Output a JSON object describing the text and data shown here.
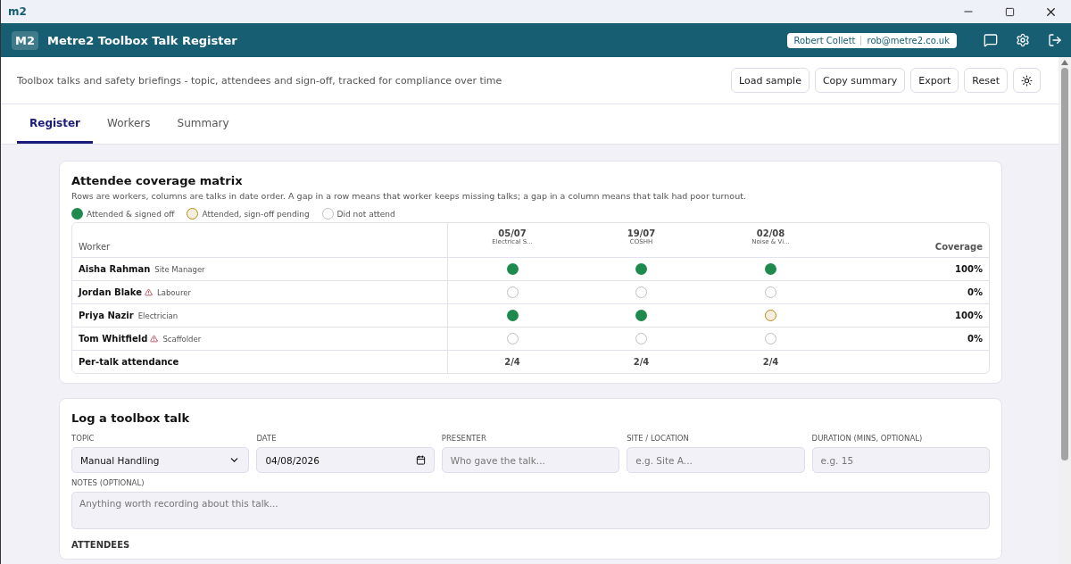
{
  "window": {
    "logo": "m2"
  },
  "app_bar": {
    "badge": "M2",
    "title": "Metre2 Toolbox Talk Register",
    "user_name": "Robert Collett",
    "user_email": "rob@metre2.co.uk"
  },
  "subtitle": "Toolbox talks and safety briefings - topic, attendees and sign-off, tracked for compliance over time",
  "actions": [
    "Load sample",
    "Copy summary",
    "Export",
    "Reset"
  ],
  "tabs": [
    {
      "label": "Register",
      "selected": true
    },
    {
      "label": "Workers",
      "selected": false
    },
    {
      "label": "Summary",
      "selected": false
    }
  ],
  "matrix": {
    "title": "Attendee coverage matrix",
    "description": "Rows are workers, columns are talks in date order. A gap in a row means that worker keeps missing talks; a gap in a column means that talk had poor turnout.",
    "legend": [
      {
        "kind": "signed",
        "label": "Attended & signed off"
      },
      {
        "kind": "pending",
        "label": "Attended, sign-off pending"
      },
      {
        "kind": "absent",
        "label": "Did not attend"
      }
    ],
    "worker_heading": "Worker",
    "coverage_heading": "Coverage",
    "talks": [
      {
        "date": "05/07",
        "topic": "Electrical S..."
      },
      {
        "date": "19/07",
        "topic": "COSHH"
      },
      {
        "date": "02/08",
        "topic": "Noise & Vi..."
      }
    ],
    "rows": [
      {
        "name": "Aisha Rahman",
        "role": "Site Manager",
        "warning": false,
        "cells": [
          {
            "attended": true,
            "signed_off": true
          },
          {
            "attended": true,
            "signed_off": true
          },
          {
            "attended": true,
            "signed_off": true
          }
        ],
        "coverage": "100%"
      },
      {
        "name": "Jordan Blake",
        "role": "Labourer",
        "warning": true,
        "cells": [
          {
            "attended": false
          },
          {
            "attended": false
          },
          {
            "attended": false
          }
        ],
        "coverage": "0%"
      },
      {
        "name": "Priya Nazir",
        "role": "Electrician",
        "warning": false,
        "cells": [
          {
            "attended": true,
            "signed_off": true
          },
          {
            "attended": true,
            "signed_off": true
          },
          {
            "attended": true,
            "signed_off": false
          }
        ],
        "coverage": "100%"
      },
      {
        "name": "Tom Whitfield",
        "role": "Scaffolder",
        "warning": true,
        "cells": [
          {
            "attended": false
          },
          {
            "attended": false
          },
          {
            "attended": false
          }
        ],
        "coverage": "0%"
      }
    ],
    "footer": {
      "label": "Per-talk attendance",
      "values": [
        "2/4",
        "2/4",
        "2/4"
      ]
    }
  },
  "log_form": {
    "title": "Log a toolbox talk",
    "fields": [
      {
        "kind": "select",
        "label": "TOPIC",
        "value": "Manual Handling"
      },
      {
        "kind": "date",
        "label": "DATE",
        "value": "04/08/2026"
      },
      {
        "kind": "text",
        "label": "PRESENTER",
        "placeholder": "Who gave the talk..."
      },
      {
        "kind": "text",
        "label": "SITE / LOCATION",
        "placeholder": "e.g. Site A..."
      },
      {
        "kind": "text",
        "label": "DURATION (MINS, OPTIONAL)",
        "placeholder": "e.g. 15"
      }
    ],
    "notes": {
      "label": "NOTES (OPTIONAL)",
      "placeholder": "Anything worth recording about this talk..."
    },
    "attendees_heading": "ATTENDEES"
  }
}
